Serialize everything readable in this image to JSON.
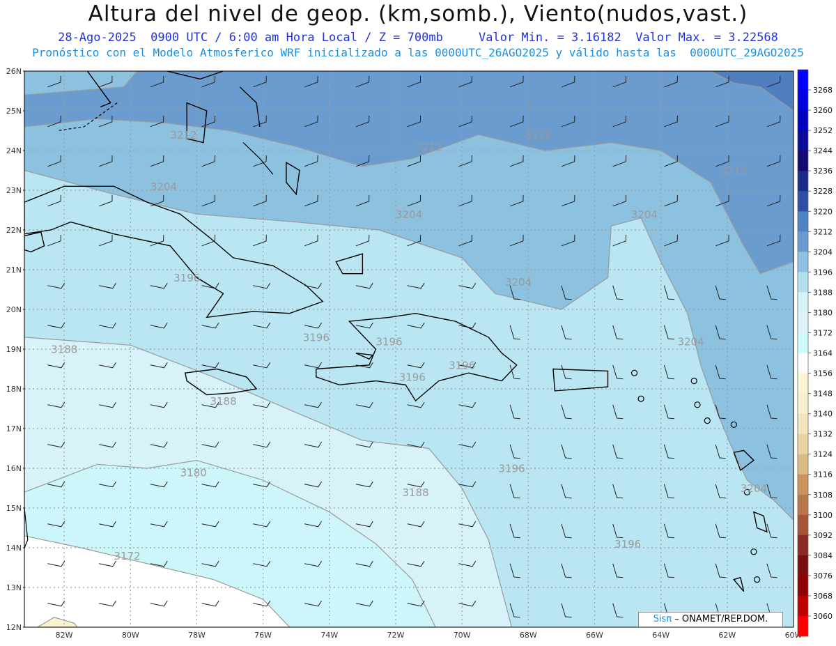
{
  "header": {
    "title": "Altura del nivel de geop. (km,somb.), Viento(nudos,vast.)",
    "date": "28-Ago-2025",
    "time": "0900 UTC / 6:00 am Hora Local / Z = 700mb",
    "min_label": "Valor Min. = 3.16182",
    "max_label": "Valor Max. = 3.22568",
    "model_line": "Pronóstico con el Modelo Atmosferico WRF inicializado a las 0000UTC_26AGO2025 y válido hasta las  0000UTC_29AGO2025"
  },
  "credit": {
    "brand": "Sisπ",
    "text": " – ONAMET/REP.DOM."
  },
  "map": {
    "lon_range": [
      -83.2,
      -60
    ],
    "lat_range": [
      12,
      26
    ],
    "lat_labels": [
      "12N",
      "13N",
      "14N",
      "15N",
      "16N",
      "17N",
      "18N",
      "19N",
      "20N",
      "21N",
      "22N",
      "23N",
      "24N",
      "25N",
      "26N"
    ],
    "lon_labels": [
      "82W",
      "80W",
      "78W",
      "76W",
      "74W",
      "72W",
      "70W",
      "68W",
      "66W",
      "64W",
      "62W",
      "60W"
    ],
    "lon_values": [
      -82,
      -80,
      -78,
      -76,
      -74,
      -72,
      -70,
      -68,
      -66,
      -64,
      -62,
      -60
    ],
    "grid": true,
    "contour_labels": [
      {
        "text": "3212",
        "lon": -71.4,
        "lat": 24.0
      },
      {
        "text": "3212",
        "lon": -68.1,
        "lat": 24.3
      },
      {
        "text": "3212",
        "lon": -62.2,
        "lat": 23.4
      },
      {
        "text": "3212",
        "lon": -78.8,
        "lat": 24.3
      },
      {
        "text": "3204",
        "lon": -79.4,
        "lat": 23.0
      },
      {
        "text": "3204",
        "lon": -72.0,
        "lat": 22.3
      },
      {
        "text": "3204",
        "lon": -64.9,
        "lat": 22.3
      },
      {
        "text": "3204",
        "lon": -68.7,
        "lat": 20.6
      },
      {
        "text": "3204",
        "lon": -63.5,
        "lat": 19.1
      },
      {
        "text": "3204",
        "lon": -61.6,
        "lat": 15.4
      },
      {
        "text": "3196",
        "lon": -78.7,
        "lat": 20.7
      },
      {
        "text": "3196",
        "lon": -74.8,
        "lat": 19.2
      },
      {
        "text": "3196",
        "lon": -72.6,
        "lat": 19.1
      },
      {
        "text": "3196",
        "lon": -71.9,
        "lat": 18.2
      },
      {
        "text": "3196",
        "lon": -70.4,
        "lat": 18.5
      },
      {
        "text": "3196",
        "lon": -68.9,
        "lat": 15.9
      },
      {
        "text": "3196",
        "lon": -65.4,
        "lat": 14.0
      },
      {
        "text": "3188",
        "lon": -82.4,
        "lat": 18.9
      },
      {
        "text": "3188",
        "lon": -77.6,
        "lat": 17.6
      },
      {
        "text": "3188",
        "lon": -71.8,
        "lat": 15.3
      },
      {
        "text": "3180",
        "lon": -78.5,
        "lat": 15.8
      },
      {
        "text": "3172",
        "lon": -80.5,
        "lat": 13.7
      }
    ],
    "levels": [
      3172,
      3180,
      3188,
      3196,
      3204,
      3212,
      3220
    ]
  },
  "colorbar": {
    "ticks": [
      3268,
      3260,
      3252,
      3244,
      3236,
      3228,
      3220,
      3212,
      3204,
      3196,
      3188,
      3180,
      3172,
      3164,
      3156,
      3148,
      3140,
      3132,
      3124,
      3116,
      3108,
      3100,
      3092,
      3084,
      3076,
      3068,
      3060
    ],
    "colors": [
      "#0000ff",
      "#0000e0",
      "#0000c0",
      "#0b0b98",
      "#140a72",
      "#1c2a8a",
      "#2f4ea6",
      "#4f82c2",
      "#6a9bcf",
      "#8fc1e2",
      "#b3e0ef",
      "#d6f3f8",
      "#dff4fa",
      "#cdfcfd",
      "#ffffff",
      "#fdf6d4",
      "#f8efd0",
      "#f2e4be",
      "#ead4a4",
      "#dcbc84",
      "#c9955b",
      "#b8774a",
      "#a65438",
      "#8c2a25",
      "#7a0f12",
      "#900000",
      "#c00000",
      "#ff0000"
    ]
  },
  "colors": {
    "land_outline": "#000000",
    "contour": "#9a9a9a",
    "grid": "#9c9c9c"
  }
}
